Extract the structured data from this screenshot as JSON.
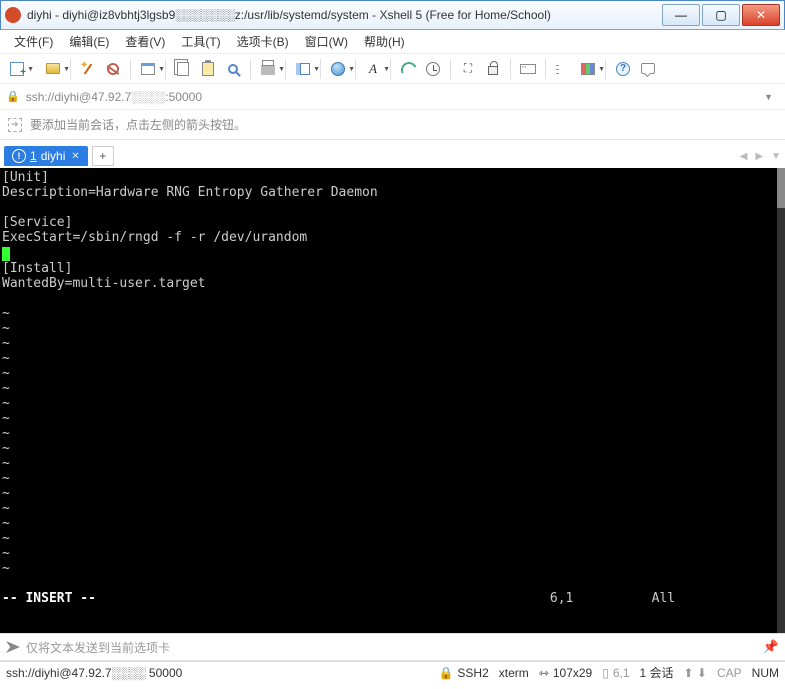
{
  "title": "diyhi - diyhi@iz8vbhtj3lgsb9░░░░░░░z:/usr/lib/systemd/system - Xshell 5 (Free for Home/School)",
  "menu": {
    "file": "文件(F)",
    "edit": "编辑(E)",
    "view": "查看(V)",
    "tools": "工具(T)",
    "tab": "选项卡(B)",
    "window": "窗口(W)",
    "help": "帮助(H)"
  },
  "address": "ssh://diyhi@47.92.7░░░░:50000",
  "hint": "要添加当前会话，点击左侧的箭头按钮。",
  "tab": {
    "num": "1",
    "name": "diyhi"
  },
  "terminal": {
    "lines": [
      "[Unit]",
      "Description=Hardware RNG Entropy Gatherer Daemon",
      "",
      "[Service]",
      "ExecStart=/sbin/rngd -f -r /dev/urandom"
    ],
    "after_cursor": [
      "[Install]",
      "WantedBy=multi-user.target"
    ],
    "mode": "-- INSERT --",
    "pos": "6,1",
    "view": "All"
  },
  "input_placeholder": "仅将文本发送到当前选项卡",
  "status": {
    "conn": "ssh://diyhi@47.92.7░░░░ 50000",
    "proto": "SSH2",
    "term": "xterm",
    "size": "107x29",
    "cursor": "6,1",
    "sessions": "1 会话",
    "cap": "CAP",
    "num": "NUM"
  }
}
